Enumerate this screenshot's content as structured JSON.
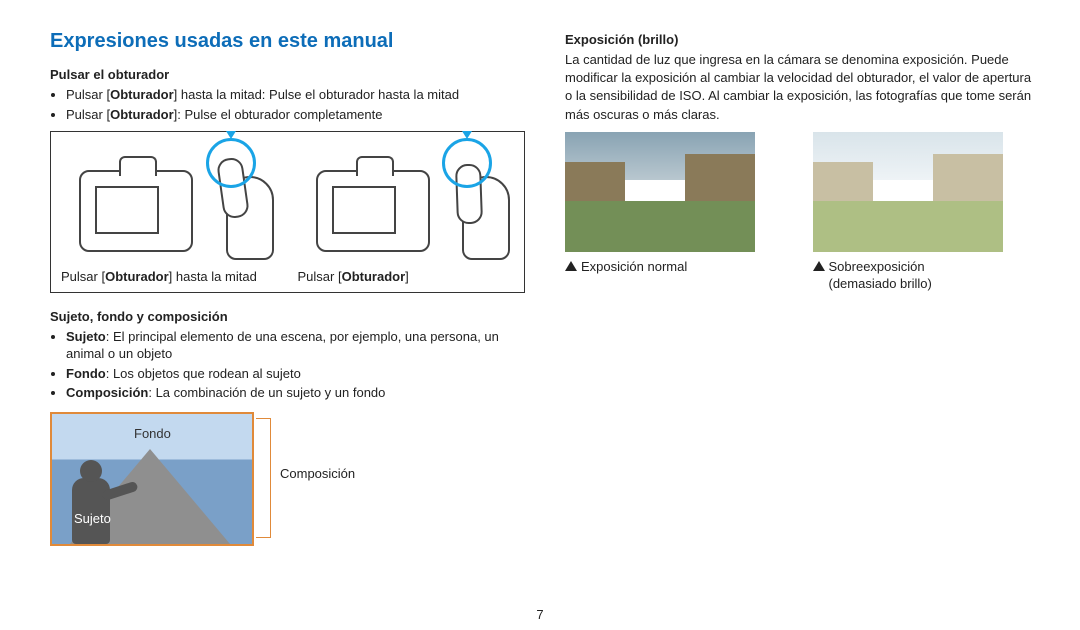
{
  "page_number": "7",
  "left": {
    "section_title": "Expresiones usadas en este manual",
    "sub1_title": "Pulsar el obturador",
    "sub1_bullet1_a": "Pulsar [",
    "sub1_bullet1_b": "Obturador",
    "sub1_bullet1_c": "] hasta la mitad: Pulse el obturador hasta la mitad",
    "sub1_bullet2_a": "Pulsar [",
    "sub1_bullet2_b": "Obturador",
    "sub1_bullet2_c": "]: Pulse el obturador completamente",
    "camera_caption1_a": "Pulsar [",
    "camera_caption1_b": "Obturador",
    "camera_caption1_c": "] hasta la mitad",
    "camera_caption2_a": "Pulsar [",
    "camera_caption2_b": "Obturador",
    "camera_caption2_c": "]",
    "sub2_title": "Sujeto, fondo y composición",
    "sub2_b1_a": "Sujeto",
    "sub2_b1_b": ": El principal elemento de una escena, por ejemplo, una persona, un animal o un objeto",
    "sub2_b2_a": "Fondo",
    "sub2_b2_b": ": Los objetos que rodean al sujeto",
    "sub2_b3_a": "Composición",
    "sub2_b3_b": ": La combinación de un sujeto y un fondo",
    "label_fondo": "Fondo",
    "label_sujeto": "Sujeto",
    "label_compos": "Composición"
  },
  "right": {
    "sub_title": "Exposición (brillo)",
    "desc": "La cantidad de luz que ingresa en la cámara se denomina exposición. Puede modificar la exposición al cambiar la velocidad del obturador, el valor de apertura o la sensibilidad de ISO. Al cambiar la exposición, las fotografías que tome serán más oscuras o más claras.",
    "caption_normal": "Exposición normal",
    "caption_over_a": "Sobreexposición",
    "caption_over_b": "(demasiado brillo)"
  }
}
